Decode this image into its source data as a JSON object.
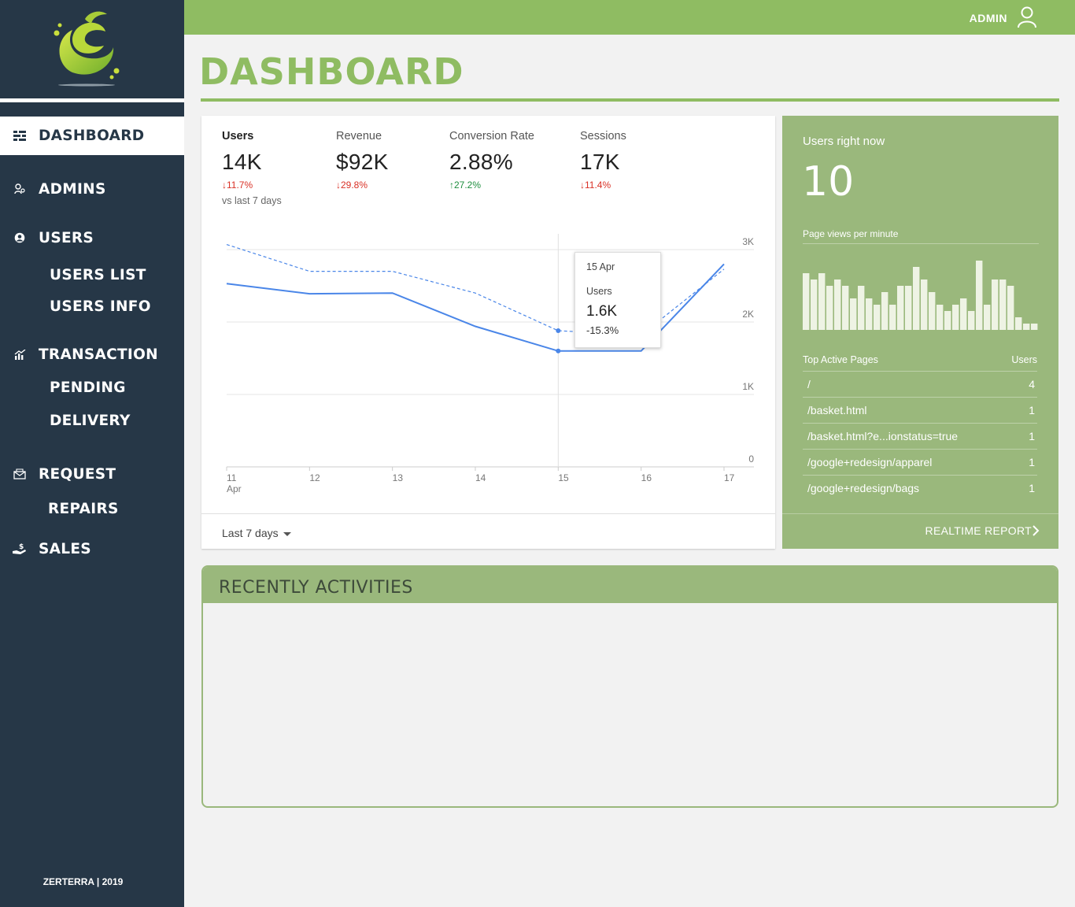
{
  "sidebar": {
    "nav": [
      {
        "label": "DASHBOARD",
        "icon": "dashboard-icon"
      },
      {
        "label": "ADMINS",
        "icon": "admins-icon"
      },
      {
        "label": "USERS",
        "icon": "user-circle-icon"
      },
      {
        "label": "TRANSACTION",
        "icon": "chart-icon"
      },
      {
        "label": "REQUEST",
        "icon": "envelope-icon"
      },
      {
        "label": "SALES",
        "icon": "hand-money-icon"
      }
    ],
    "users_sub": [
      "USERS LIST",
      "USERS INFO"
    ],
    "transaction_sub": [
      "PENDING",
      "DELIVERY"
    ],
    "request_sub": [
      "REPAIRS"
    ],
    "footer": "ZERTERRA | 2019"
  },
  "topbar": {
    "user_label": "ADMIN",
    "user_icon": "user-icon"
  },
  "page": {
    "title": "DASHBOARD"
  },
  "overview": {
    "metrics": [
      {
        "label": "Users",
        "value": "14K",
        "delta": "11.7%",
        "direction": "down",
        "note": "vs last 7 days"
      },
      {
        "label": "Revenue",
        "value": "$92K",
        "delta": "29.8%",
        "direction": "down"
      },
      {
        "label": "Conversion Rate",
        "value": "2.88%",
        "delta": "27.2%",
        "direction": "up"
      },
      {
        "label": "Sessions",
        "value": "17K",
        "delta": "11.4%",
        "direction": "down"
      }
    ],
    "date_range": "Last 7 days",
    "tooltip": {
      "date": "15 Apr",
      "series": "Users",
      "value": "1.6K",
      "delta": "-15.3%"
    }
  },
  "chart_data": {
    "type": "line",
    "x": [
      "11",
      "12",
      "13",
      "14",
      "15",
      "16",
      "17"
    ],
    "x_sublabel_first": "Apr",
    "y_ticks": [
      "0",
      "1K",
      "2K",
      "3K"
    ],
    "ylim": [
      0,
      3000
    ],
    "series": [
      {
        "style": "solid",
        "color": "#4a86e8",
        "values": [
          2530,
          2390,
          2400,
          1940,
          1600,
          1600,
          2800
        ]
      },
      {
        "style": "dashed",
        "color": "#4a86e8",
        "values": [
          3070,
          2700,
          2700,
          2400,
          1880,
          1820,
          2730
        ]
      }
    ],
    "highlight_x": "15",
    "grid": true
  },
  "realtime": {
    "title": "Users right now",
    "count": "10",
    "pageviews_label": "Page views per minute",
    "pageviews": [
      9,
      8,
      9,
      7,
      8,
      7,
      5,
      7,
      5,
      4,
      6,
      4,
      7,
      7,
      10,
      8,
      6,
      4,
      3,
      4,
      5,
      3,
      11,
      4,
      8,
      8,
      7,
      2,
      1,
      1
    ],
    "table_head": {
      "page": "Top Active Pages",
      "users": "Users"
    },
    "rows": [
      {
        "page": "/",
        "users": "4"
      },
      {
        "page": "/basket.html",
        "users": "1"
      },
      {
        "page": "/basket.html?e...ionstatus=true",
        "users": "1"
      },
      {
        "page": "/google+redesign/apparel",
        "users": "1"
      },
      {
        "page": "/google+redesign/bags",
        "users": "1"
      }
    ],
    "report_label": "REALTIME REPORT"
  },
  "activities": {
    "title": "RECENTLY ACTIVITIES"
  },
  "colors": {
    "accent": "#8fbc62",
    "sidebar": "#263747",
    "panel": "#9ab87c",
    "line": "#4a86e8"
  }
}
